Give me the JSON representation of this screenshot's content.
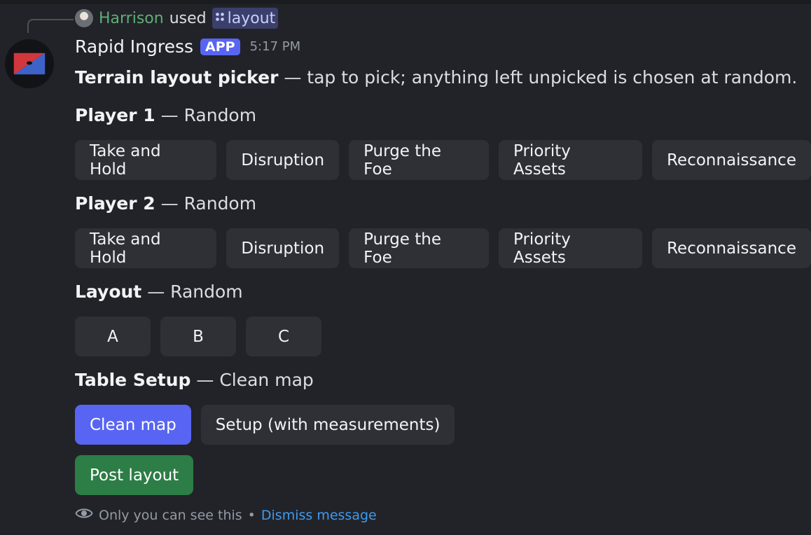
{
  "reply": {
    "user": "Harrison",
    "used_text": "used",
    "command": "layout",
    "command_icon": "apps-icon"
  },
  "message": {
    "bot_name": "Rapid Ingress",
    "badge": "APP",
    "timestamp": "5:17 PM",
    "intro_bold": "Terrain layout picker",
    "intro_rest": " — tap to pick; anything left unpicked is chosen at random."
  },
  "sections": {
    "player1": {
      "label": "Player 1",
      "value": " — Random",
      "buttons": [
        "Take and Hold",
        "Disruption",
        "Purge the Foe",
        "Priority Assets",
        "Reconnaissance"
      ]
    },
    "player2": {
      "label": "Player 2",
      "value": " — Random",
      "buttons": [
        "Take and Hold",
        "Disruption",
        "Purge the Foe",
        "Priority Assets",
        "Reconnaissance"
      ]
    },
    "layout": {
      "label": "Layout",
      "value": " — Random",
      "buttons": [
        "A",
        "B",
        "C"
      ]
    },
    "table_setup": {
      "label": "Table Setup",
      "value": " — Clean map",
      "buttons": [
        "Clean map",
        "Setup (with measurements)"
      ]
    }
  },
  "post_button": "Post layout",
  "footer": {
    "text": "Only you can see this",
    "separator": " • ",
    "dismiss": "Dismiss message"
  },
  "colors": {
    "background": "#222328",
    "button": "#2f3036",
    "primary": "#5865f2",
    "success": "#2d7d46",
    "link": "#3e9bf1",
    "username": "#5fae76"
  }
}
